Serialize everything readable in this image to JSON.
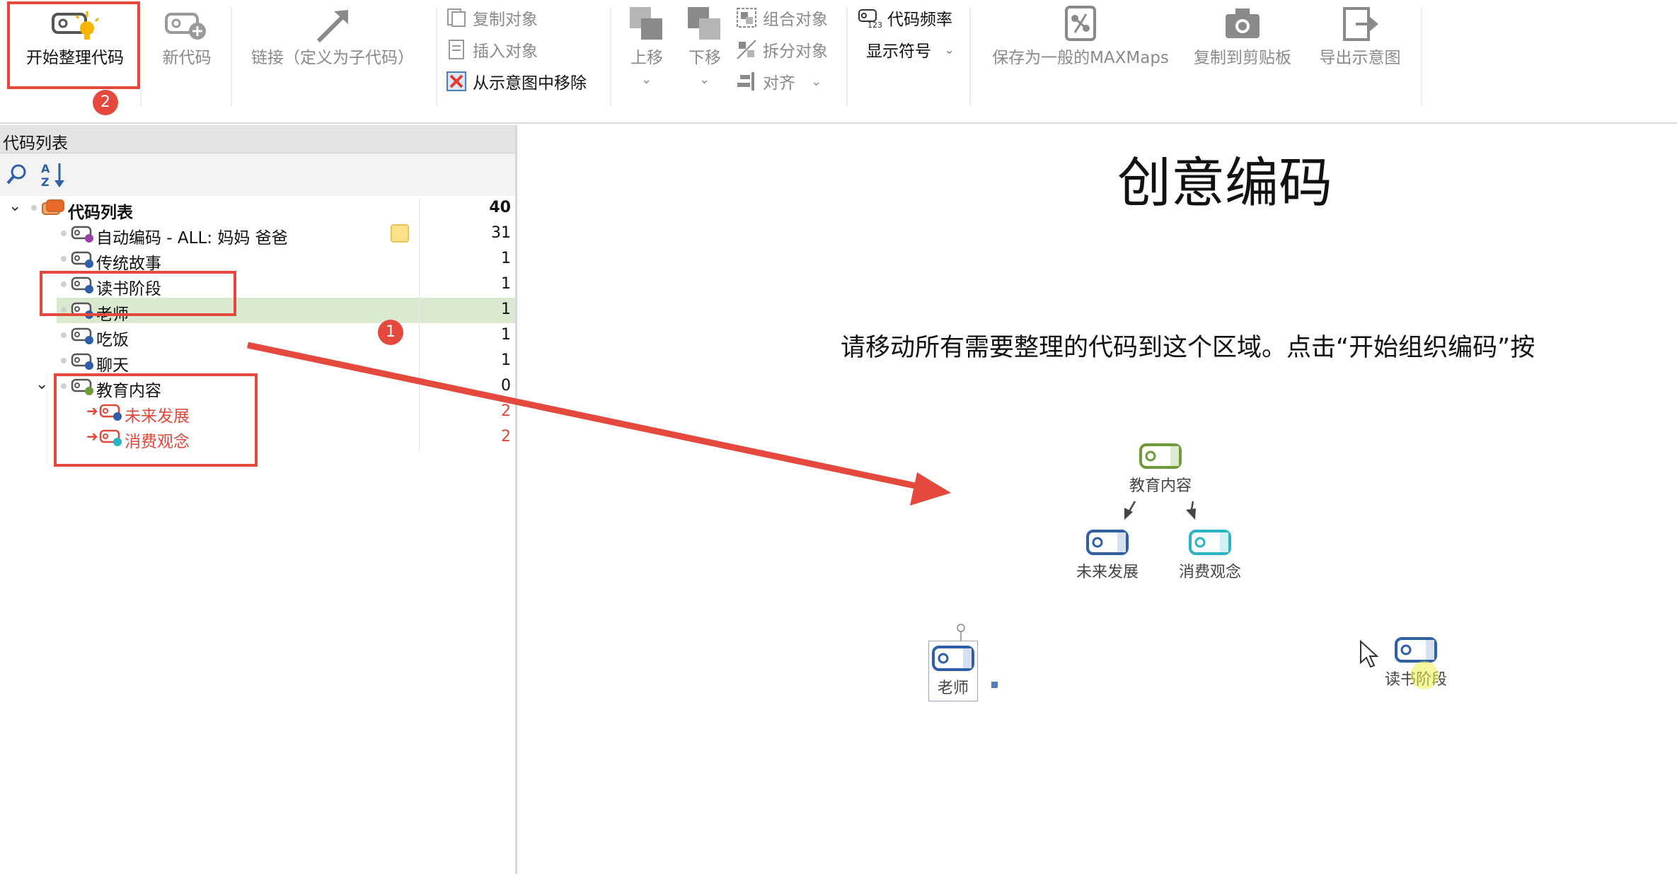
{
  "ribbon": {
    "start_organize": "开始整理代码",
    "new_code": "新代码",
    "link_subcode": "链接（定义为子代码）",
    "copy_object": "复制对象",
    "insert_object": "插入对象",
    "remove_from_map": "从示意图中移除",
    "move_up": "上移",
    "move_down": "下移",
    "group_objects": "组合对象",
    "split_objects": "拆分对象",
    "align": "对齐",
    "code_frequency": "代码频率",
    "show_symbols": "显示符号",
    "save_as_maxmaps": "保存为一般的MAXMaps",
    "copy_clipboard": "复制到剪贴板",
    "export_map": "导出示意图"
  },
  "panel": {
    "title": "代码列表",
    "tree": [
      {
        "label": "代码列表",
        "count": "40"
      },
      {
        "label": "自动编码 - ALL: 妈妈 爸爸",
        "count": "31"
      },
      {
        "label": "传统故事",
        "count": "1"
      },
      {
        "label": "读书阶段",
        "count": "1"
      },
      {
        "label": "老师",
        "count": "1"
      },
      {
        "label": "吃饭",
        "count": "1"
      },
      {
        "label": "聊天",
        "count": "1"
      },
      {
        "label": "教育内容",
        "count": "0"
      },
      {
        "label": "未来发展",
        "count": "2"
      },
      {
        "label": "消费观念",
        "count": "2"
      }
    ]
  },
  "canvas": {
    "title": "创意编码",
    "instruction": "请移动所有需要整理的代码到这个区域。点击“开始组织编码”按",
    "nodes": {
      "parent": "教育内容",
      "child1": "未来发展",
      "child2": "消费观念",
      "teacher": "老师",
      "reading": "读书阶段"
    }
  },
  "annotations": {
    "badge1": "1",
    "badge2": "2"
  },
  "colors": {
    "highlight_red": "#e5483d",
    "selection_green": "#d9ead1",
    "code_blue": "#2f5fa8",
    "code_green": "#6f9a3a",
    "code_teal": "#2ab3c6",
    "code_purple": "#9b3fae"
  }
}
